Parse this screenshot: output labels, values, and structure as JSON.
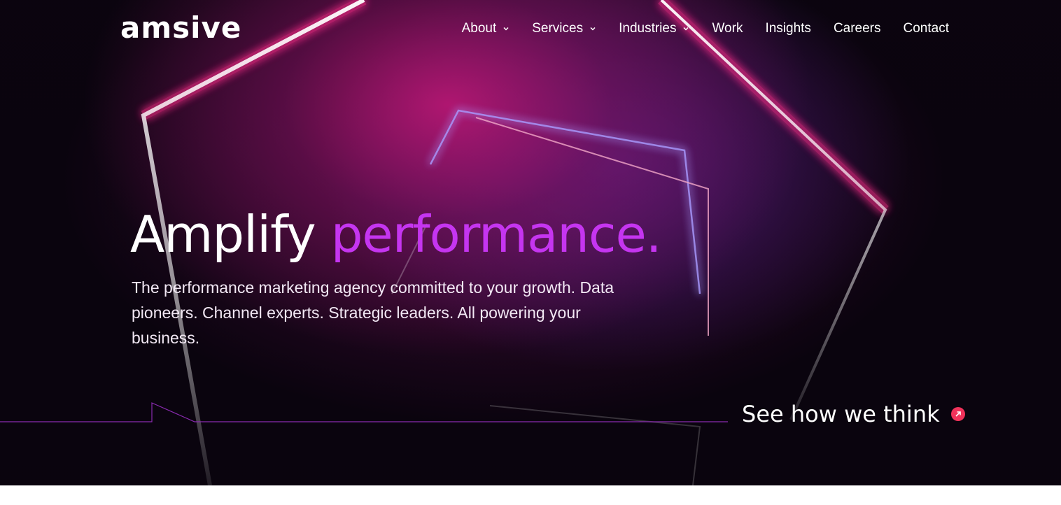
{
  "brand": {
    "logo_text": "amsive"
  },
  "nav": {
    "items": [
      {
        "label": "About",
        "has_dropdown": true
      },
      {
        "label": "Services",
        "has_dropdown": true
      },
      {
        "label": "Industries",
        "has_dropdown": true
      },
      {
        "label": "Work",
        "has_dropdown": false
      },
      {
        "label": "Insights",
        "has_dropdown": false
      },
      {
        "label": "Careers",
        "has_dropdown": false
      },
      {
        "label": "Contact",
        "has_dropdown": false
      }
    ]
  },
  "hero": {
    "headline_part1": "Amplify",
    "headline_part2": "performance.",
    "subheadline": "The performance marketing agency committed to your growth. Data pioneers. Channel experts. Strategic leaders. All powering your business.",
    "cta_label": "See how we think",
    "cta_icon": "arrow-up-right-icon"
  },
  "colors": {
    "accent_purple": "#c535f0",
    "neon_pink": "#ff2f8a",
    "cta_red": "#f0325a",
    "background_dark": "#0a0510"
  }
}
